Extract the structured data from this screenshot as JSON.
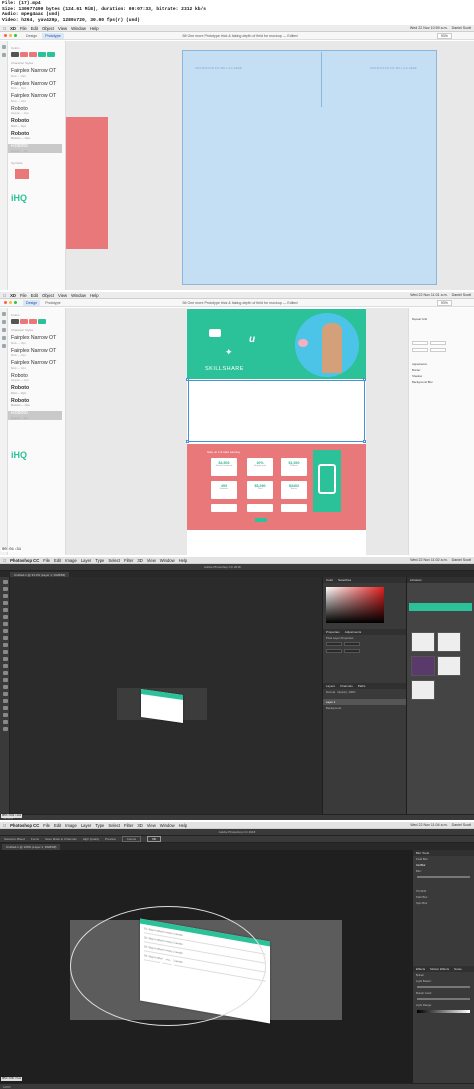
{
  "meta": {
    "line1": "File: (17).mp4",
    "line2": "Size: 130677490 bytes (124.61 MiB), duration: 00:07:33, bitrate: 2312 kb/s",
    "line3": "Audio: mpeg4aac (und)",
    "line4": "Video: h264, yuv420p, 1280x720, 30.00 fps(r) (und)"
  },
  "frames": [
    {
      "menubar": {
        "app": "XD",
        "items": [
          "File",
          "Edit",
          "Object",
          "View",
          "Window",
          "Help"
        ],
        "clock": "Wed 22 Nov 10:59 a.m.",
        "user": "Daniel Scott"
      },
      "tabs": [
        "Design",
        "Prototype"
      ],
      "active_tab": "Prototype",
      "doc_title": "58 One more Prototype trick & faking depth of field for mockup — Edited",
      "zoom": "93%",
      "guide_left": "INSTRUCTOR PIC WILL GO HERE",
      "guide_right": "INSTRUCTOR PIC WILL GO HERE",
      "timestamp": ""
    },
    {
      "menubar": {
        "app": "XD",
        "items": [
          "File",
          "Edit",
          "Object",
          "View",
          "Window",
          "Help"
        ],
        "clock": "Wed 22 Nov 11:01 a.m.",
        "user": "Daniel Scott"
      },
      "tabs": [
        "Design",
        "Prototype"
      ],
      "active_tab": "Design",
      "doc_title": "58 One more Prototype trick & faking depth of field for mockup — Edited",
      "zoom": "93%",
      "hero_brand": "SKILLSHARE",
      "stats_title": "Stay on it & start earning",
      "stats": [
        {
          "v": "$4,503",
          "l": "Minutes watched"
        },
        {
          "v": "10%",
          "l": "Royalty pool"
        },
        {
          "v": "$1,920",
          "l": "Referral"
        },
        {
          "v": "493",
          "l": "Students"
        },
        {
          "v": "$5,290",
          "l": "Total"
        },
        {
          "v": "$3402",
          "l": "Bonus"
        }
      ],
      "props": [
        "Repeat Grid",
        "Appearance",
        "Border",
        "Shadow",
        "Background Blur"
      ],
      "timestamp": "00:01:31"
    },
    {
      "menubar": {
        "app": "Photoshop CC",
        "items": [
          "File",
          "Edit",
          "Image",
          "Layer",
          "Type",
          "Select",
          "Filter",
          "3D",
          "View",
          "Window",
          "Help"
        ],
        "clock": "Wed 22 Nov 11:02 a.m.",
        "user": "Daniel Scott"
      },
      "app_title": "Adobe Photoshop CC 2018",
      "doc_tab": "Untitled-1 @ 33.3% (Layer 1, RGB/8#)",
      "panels": {
        "color_tabs": [
          "Color",
          "Swatches"
        ],
        "library_title": "Libraries",
        "props_tabs": [
          "Properties",
          "Adjustments"
        ],
        "props_sub": "Pixel Layer Properties",
        "layers_tabs": [
          "Layers",
          "Channels",
          "Paths"
        ],
        "blend": "Normal",
        "opacity": "Opacity: 100%",
        "layers": [
          "Layer 1",
          "Background"
        ]
      },
      "status": "33.33%",
      "timestamp": "00:04:31"
    },
    {
      "menubar": {
        "app": "Photoshop CC",
        "items": [
          "File",
          "Edit",
          "Image",
          "Layer",
          "Type",
          "Select",
          "Filter",
          "3D",
          "View",
          "Window",
          "Help"
        ],
        "clock": "Wed 22 Nov 11:04 a.m.",
        "user": "Daniel Scott"
      },
      "app_title": "Adobe Photoshop CC 2018",
      "doc_tab": "Untitled-1 @ 100% (Layer 1, RGB/8#)",
      "options": [
        "Selection Bleed",
        "Focus",
        "Save Mask to Channels",
        "High Quality",
        "Preview",
        "Cancel",
        "OK"
      ],
      "blur_tools": {
        "title": "Blur Tools",
        "items": [
          "Field Blur",
          "Iris Blur",
          "Blur:",
          "Tilt-Shift",
          "Path Blur",
          "Spin Blur"
        ]
      },
      "effects": {
        "tabs": [
          "Effects",
          "Motion Effects",
          "Noise"
        ],
        "items": [
          "Bokeh",
          "Light Bokeh:",
          "Bokeh Color:",
          "Light Range:"
        ]
      },
      "sheet_lines": [
        "01. Stop in artist in every 2 weeks",
        "02. Stop in artist in every 2 weeks",
        "03. Stop in artist in every 2 weeks",
        "04. Stop in artist in every 2 weeks"
      ],
      "status": "100%",
      "timestamp": "00:05:51"
    }
  ],
  "assets": {
    "colors_label": "Colors",
    "fonts_label": "Character Styles",
    "fonts": [
      {
        "name": "Fairplex Narrow OT",
        "sub": "Book — 16px",
        "bold": false
      },
      {
        "name": "Fairplex Narrow OT",
        "sub": "Book — 14px",
        "bold": false
      },
      {
        "name": "Fairplex Narrow OT",
        "sub": "Book — 12px",
        "bold": false
      },
      {
        "name": "Roboto",
        "sub": "Regular — 11px",
        "bold": false
      },
      {
        "name": "Roboto",
        "sub": "Bold — 11px",
        "bold": true
      },
      {
        "name": "Roboto",
        "sub": "Medium — 11px",
        "bold": true
      },
      {
        "name": "Roboto",
        "sub": "Regular — 9px",
        "bold": false
      }
    ],
    "symbols_label": "Symbols",
    "logo": "iHQ",
    "instructor": "instructorHQ"
  },
  "colors": {
    "green": "#2bc29a",
    "coral": "#e8787a",
    "blue": "#c4def3",
    "psdark": "#282828"
  }
}
